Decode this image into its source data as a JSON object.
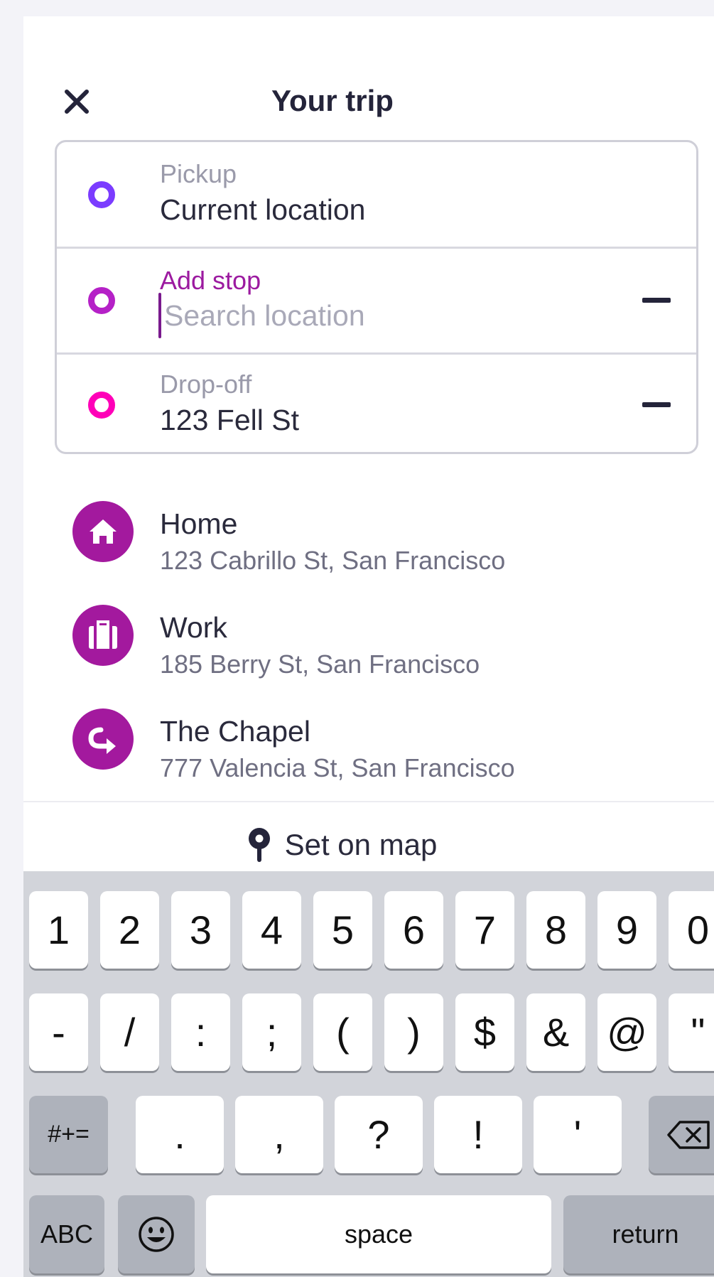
{
  "header": {
    "title": "Your trip",
    "close_icon": "close-icon"
  },
  "stops": [
    {
      "label": "Pickup",
      "value": "Current location",
      "dot_color": "#7b3cff",
      "removable": false
    },
    {
      "label": "Add stop",
      "value": "",
      "placeholder": "Search location",
      "dot_color": "#b521c7",
      "removable": true,
      "focused": true
    },
    {
      "label": "Drop-off",
      "value": "123 Fell St",
      "dot_color": "#ff00b8",
      "removable": true
    }
  ],
  "places": [
    {
      "name": "Home",
      "address": "123 Cabrillo St, San Francisco",
      "icon": "home-icon"
    },
    {
      "name": "Work",
      "address": "185 Berry St, San Francisco",
      "icon": "briefcase-icon"
    },
    {
      "name": "The Chapel",
      "address": "777 Valencia St, San Francisco",
      "icon": "arrow-turn-icon"
    }
  ],
  "set_on_map": {
    "label": "Set on map",
    "icon": "map-pin-icon"
  },
  "keyboard": {
    "row1": [
      "1",
      "2",
      "3",
      "4",
      "5",
      "6",
      "7",
      "8",
      "9",
      "0"
    ],
    "row2": [
      "-",
      "/",
      ":",
      ";",
      "(",
      ")",
      "$",
      "&",
      "@",
      "\""
    ],
    "row3_left": "#+=",
    "row3": [
      ".",
      ",",
      "?",
      "!",
      "'"
    ],
    "row3_right_icon": "backspace-icon",
    "row4": {
      "abc": "ABC",
      "emoji_icon": "emoji-icon",
      "space": "space",
      "return": "return"
    }
  },
  "colors": {
    "accent": "#a3199e",
    "text": "#2a2a3c",
    "muted": "#9a9aaa"
  }
}
